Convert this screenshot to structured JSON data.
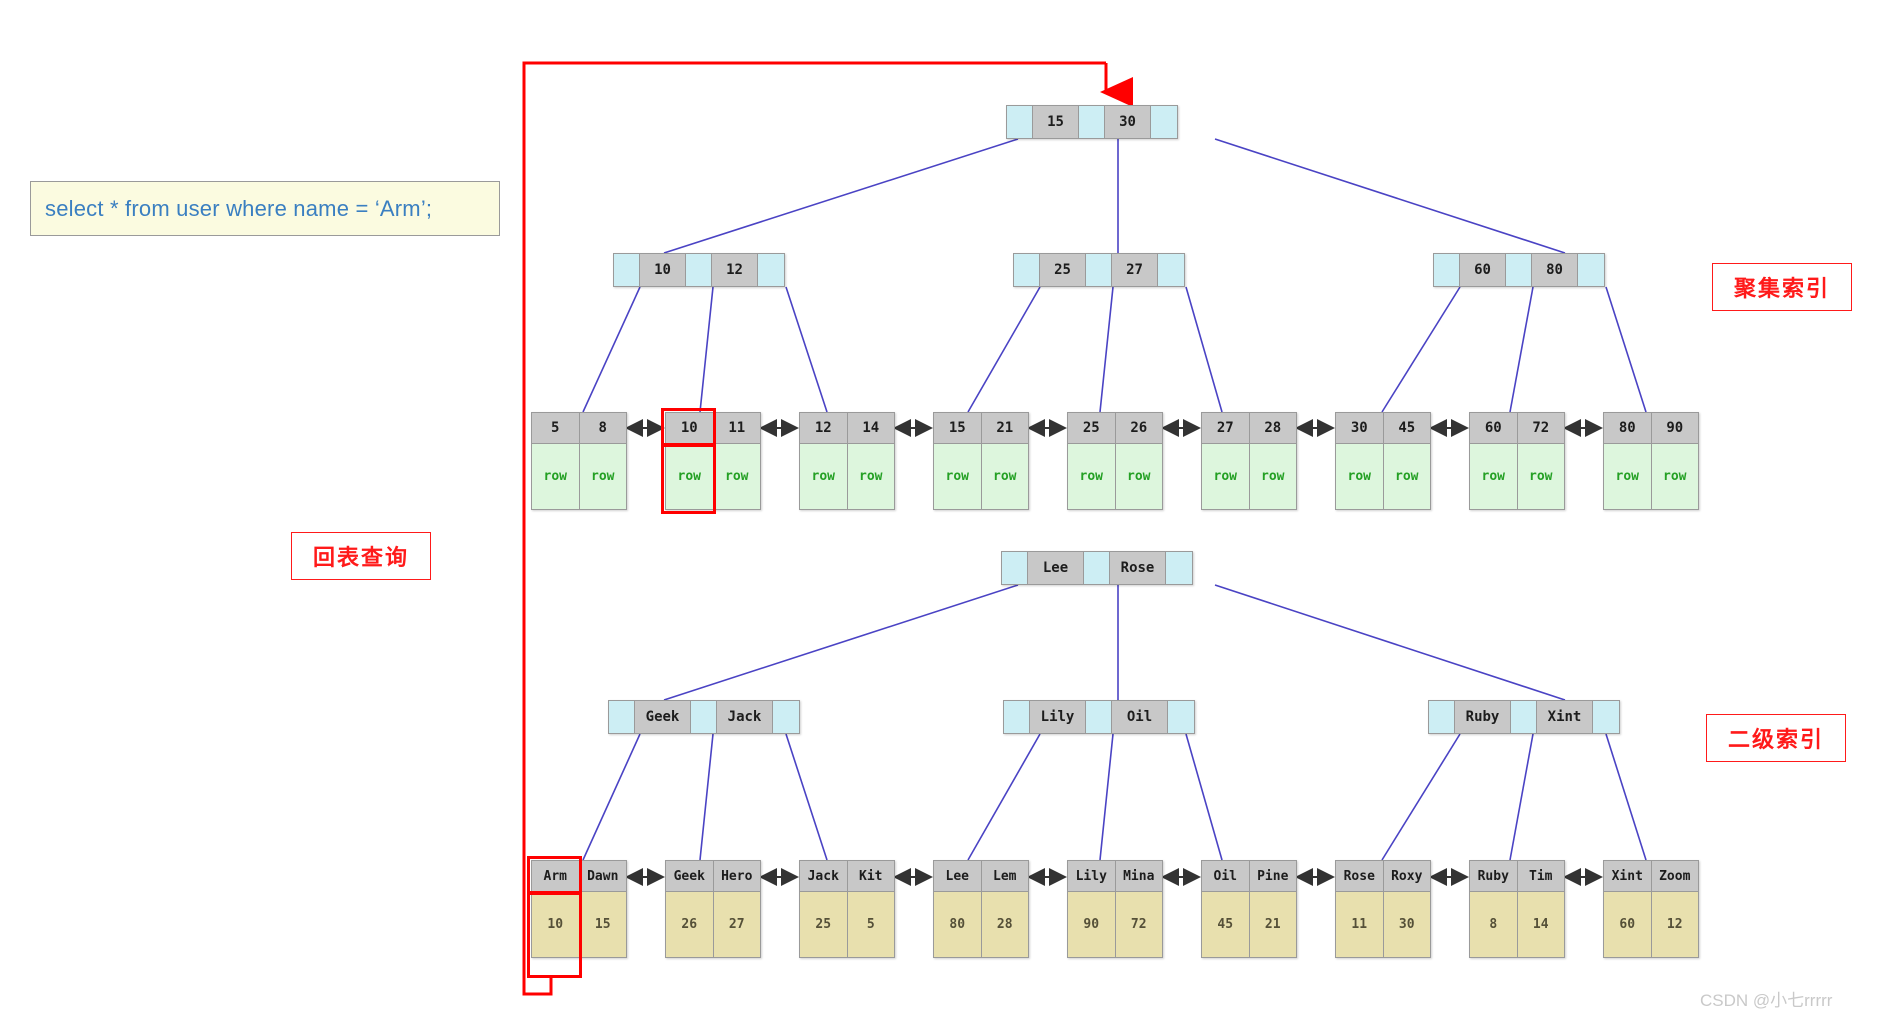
{
  "title": "InnoDB B+Tree clustered index and secondary index lookup diagram",
  "sql_callout": {
    "text": "select * from user where name = ‘Arm’;"
  },
  "annotations": {
    "clustered_index": "聚集索引",
    "secondary_index": "二级索引",
    "table_lookup": "回表查询"
  },
  "watermark": "CSDN @小七rrrrr",
  "colors": {
    "pointer_cell": "#cdeef4",
    "key_cell": "#c8c8c8",
    "clustered_payload": "#ddf6dd",
    "clustered_payload_text": "#24a024",
    "secondary_payload": "#e8e0ae",
    "edge_line": "#4a43c4",
    "highlight": "#ff0000",
    "sql_box_bg": "#fbfbe0",
    "sql_text": "#3a7fc1"
  },
  "clustered_index": {
    "label": "聚集索引",
    "root": {
      "keys": [
        "15",
        "30"
      ]
    },
    "internal": [
      {
        "keys": [
          "10",
          "12"
        ]
      },
      {
        "keys": [
          "25",
          "27"
        ]
      },
      {
        "keys": [
          "60",
          "80"
        ]
      }
    ],
    "leaves": [
      {
        "keys": [
          "5",
          "8"
        ],
        "rows": [
          "row",
          "row"
        ]
      },
      {
        "keys": [
          "10",
          "11"
        ],
        "rows": [
          "row",
          "row"
        ]
      },
      {
        "keys": [
          "12",
          "14"
        ],
        "rows": [
          "row",
          "row"
        ]
      },
      {
        "keys": [
          "15",
          "21"
        ],
        "rows": [
          "row",
          "row"
        ]
      },
      {
        "keys": [
          "25",
          "26"
        ],
        "rows": [
          "row",
          "row"
        ]
      },
      {
        "keys": [
          "27",
          "28"
        ],
        "rows": [
          "row",
          "row"
        ]
      },
      {
        "keys": [
          "30",
          "45"
        ],
        "rows": [
          "row",
          "row"
        ]
      },
      {
        "keys": [
          "60",
          "72"
        ],
        "rows": [
          "row",
          "row"
        ]
      },
      {
        "keys": [
          "80",
          "90"
        ],
        "rows": [
          "row",
          "row"
        ]
      }
    ],
    "highlighted_leaf_index": 1,
    "highlighted_cell_index": 0,
    "highlighted_key": "10"
  },
  "secondary_index": {
    "label": "二级索引",
    "root": {
      "keys": [
        "Lee",
        "Rose"
      ]
    },
    "internal": [
      {
        "keys": [
          "Geek",
          "Jack"
        ]
      },
      {
        "keys": [
          "Lily",
          "Oil"
        ]
      },
      {
        "keys": [
          "Ruby",
          "Xint"
        ]
      }
    ],
    "leaves": [
      {
        "keys": [
          "Arm",
          "Dawn"
        ],
        "pks": [
          "10",
          "15"
        ]
      },
      {
        "keys": [
          "Geek",
          "Hero"
        ],
        "pks": [
          "26",
          "27"
        ]
      },
      {
        "keys": [
          "Jack",
          "Kit"
        ],
        "pks": [
          "25",
          "5"
        ]
      },
      {
        "keys": [
          "Lee",
          "Lem"
        ],
        "pks": [
          "80",
          "28"
        ]
      },
      {
        "keys": [
          "Lily",
          "Mina"
        ],
        "pks": [
          "90",
          "72"
        ]
      },
      {
        "keys": [
          "Oil",
          "Pine"
        ],
        "pks": [
          "45",
          "21"
        ]
      },
      {
        "keys": [
          "Rose",
          "Roxy"
        ],
        "pks": [
          "11",
          "30"
        ]
      },
      {
        "keys": [
          "Ruby",
          "Tim"
        ],
        "pks": [
          "8",
          "14"
        ]
      },
      {
        "keys": [
          "Xint",
          "Zoom"
        ],
        "pks": [
          "60",
          "12"
        ]
      }
    ],
    "highlighted_leaf_index": 0,
    "highlighted_cell_index": 0,
    "highlighted_key": "Arm",
    "highlighted_pk": "10"
  }
}
